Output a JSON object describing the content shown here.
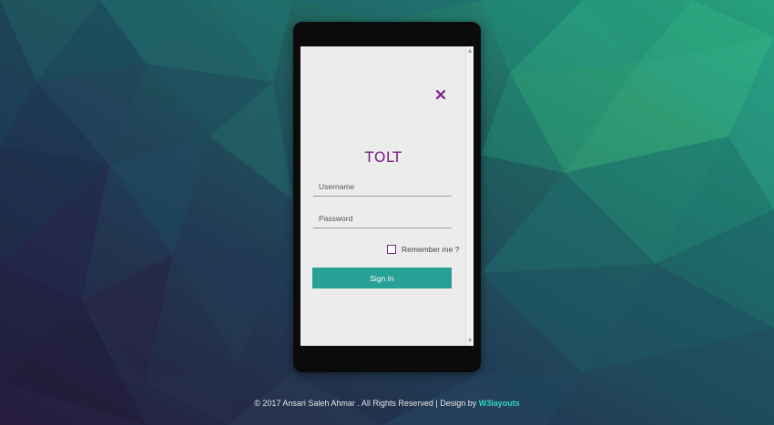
{
  "login": {
    "title": "TOLT",
    "username_placeholder": "Username",
    "password_placeholder": "Password",
    "remember_label": "Remember me ?",
    "signin_label": "Sign In",
    "close_icon": "close-x-icon"
  },
  "footer": {
    "text": "© 2017 Ansari Saleh Ahmar . All Rights Reserved | Design by ",
    "brand": "W3layouts"
  },
  "colors": {
    "accent": "#7a1f86",
    "button": "#27a096",
    "brand_link": "#2fd4c9"
  }
}
